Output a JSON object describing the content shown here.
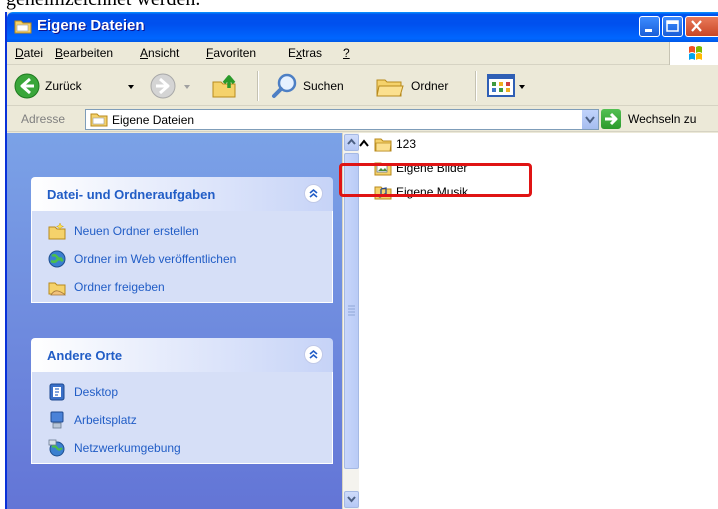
{
  "caption": {
    "text": "geheimzeichnet werden."
  },
  "window": {
    "title": "Eigene Dateien",
    "title_icon": "folder-icon",
    "buttons": {
      "minimize": "minimize-icon",
      "maximize": "maximize-icon",
      "close": "close-icon"
    }
  },
  "menu": {
    "items": [
      {
        "pre": "",
        "ul": "D",
        "post": "atei"
      },
      {
        "pre": "",
        "ul": "B",
        "post": "earbeiten"
      },
      {
        "pre": "",
        "ul": "A",
        "post": "nsicht"
      },
      {
        "pre": "",
        "ul": "F",
        "post": "avoriten"
      },
      {
        "pre": "E",
        "ul": "x",
        "post": "tras"
      },
      {
        "pre": "",
        "ul": "?",
        "post": ""
      }
    ]
  },
  "toolbar": {
    "back_label": "Zurück",
    "search_label": "Suchen",
    "folders_label": "Ordner"
  },
  "address": {
    "label": "Adresse",
    "value": "Eigene Dateien",
    "go_label": "Wechseln zu"
  },
  "tasks_panel": {
    "title": "Datei- und Ordneraufgaben",
    "items": [
      {
        "label": "Neuen Ordner erstellen",
        "icon": "new-folder-icon"
      },
      {
        "label": "Ordner im Web veröffentlichen",
        "icon": "web-publish-icon"
      },
      {
        "label": "Ordner freigeben",
        "icon": "share-folder-icon"
      }
    ]
  },
  "places_panel": {
    "title": "Andere Orte",
    "items": [
      {
        "label": "Desktop",
        "icon": "desktop-icon"
      },
      {
        "label": "Arbeitsplatz",
        "icon": "my-computer-icon"
      },
      {
        "label": "Netzwerkumgebung",
        "icon": "network-icon"
      }
    ]
  },
  "files": {
    "items": [
      {
        "name": "123",
        "icon": "folder-icon"
      },
      {
        "name": "Eigene Bilder",
        "icon": "pictures-folder-icon"
      },
      {
        "name": "Eigene Musik",
        "icon": "music-folder-icon"
      }
    ]
  },
  "colors": {
    "title_bar": "#0054e3",
    "task_link": "#215dc6",
    "highlight": "#e01414"
  }
}
